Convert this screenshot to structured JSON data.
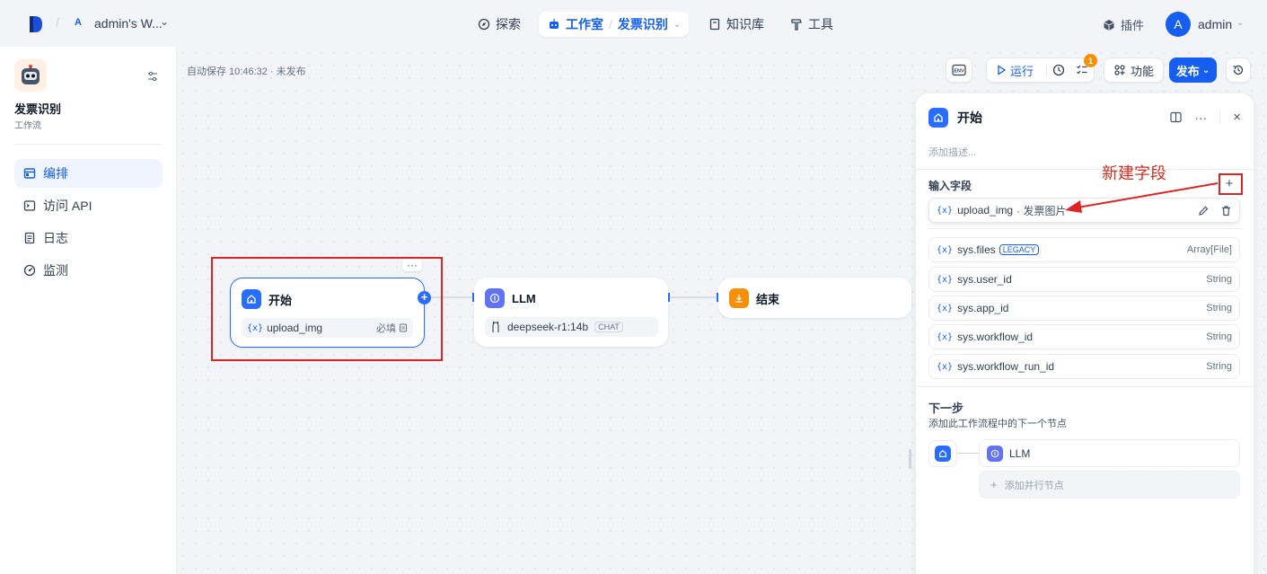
{
  "header": {
    "workspace_badge": "A",
    "workspace_name": "admin's W...",
    "nav": {
      "explore": "探索",
      "studio": "工作室",
      "studio_app": "发票识别",
      "knowledge": "知识库",
      "tools": "工具"
    },
    "plugins": "插件",
    "avatar_initial": "A",
    "username": "admin"
  },
  "sidebar": {
    "app_title": "发票识别",
    "app_type": "工作流",
    "items": [
      {
        "label": "编排",
        "icon": "layout-icon",
        "active": true
      },
      {
        "label": "访问 API",
        "icon": "terminal-icon",
        "active": false
      },
      {
        "label": "日志",
        "icon": "log-icon",
        "active": false
      },
      {
        "label": "监测",
        "icon": "monitor-icon",
        "active": false
      }
    ]
  },
  "canvas": {
    "autosave": "自动保存 10:46:32 · 未发布",
    "toolbar": {
      "env": "ENV",
      "run": "运行",
      "notification_count": "1",
      "features": "功能",
      "publish": "发布"
    },
    "nodes": {
      "start": {
        "title": "开始",
        "var_name": "upload_img",
        "required": "必填"
      },
      "llm": {
        "title": "LLM",
        "model": "deepseek-r1:14b",
        "mode": "CHAT"
      },
      "end": {
        "title": "结束"
      }
    },
    "annotation": "新建字段"
  },
  "panel": {
    "title": "开始",
    "desc_placeholder": "添加描述...",
    "input_fields_label": "输入字段",
    "user_field": {
      "name": "upload_img",
      "desc": "· 发票图片"
    },
    "system_fields": [
      {
        "name": "sys.files",
        "badge": "LEGACY",
        "type": "Array[File]"
      },
      {
        "name": "sys.user_id",
        "type": "String"
      },
      {
        "name": "sys.app_id",
        "type": "String"
      },
      {
        "name": "sys.workflow_id",
        "type": "String"
      },
      {
        "name": "sys.workflow_run_id",
        "type": "String"
      }
    ],
    "next_step": {
      "title": "下一步",
      "subtitle": "添加此工作流程中的下一个节点",
      "node": "LLM",
      "add_parallel": "添加并行节点"
    }
  },
  "colors": {
    "accent": "#155EEF",
    "annotation_red": "#E02424",
    "end_node": "#F79009",
    "llm_node": "#6172F3"
  }
}
